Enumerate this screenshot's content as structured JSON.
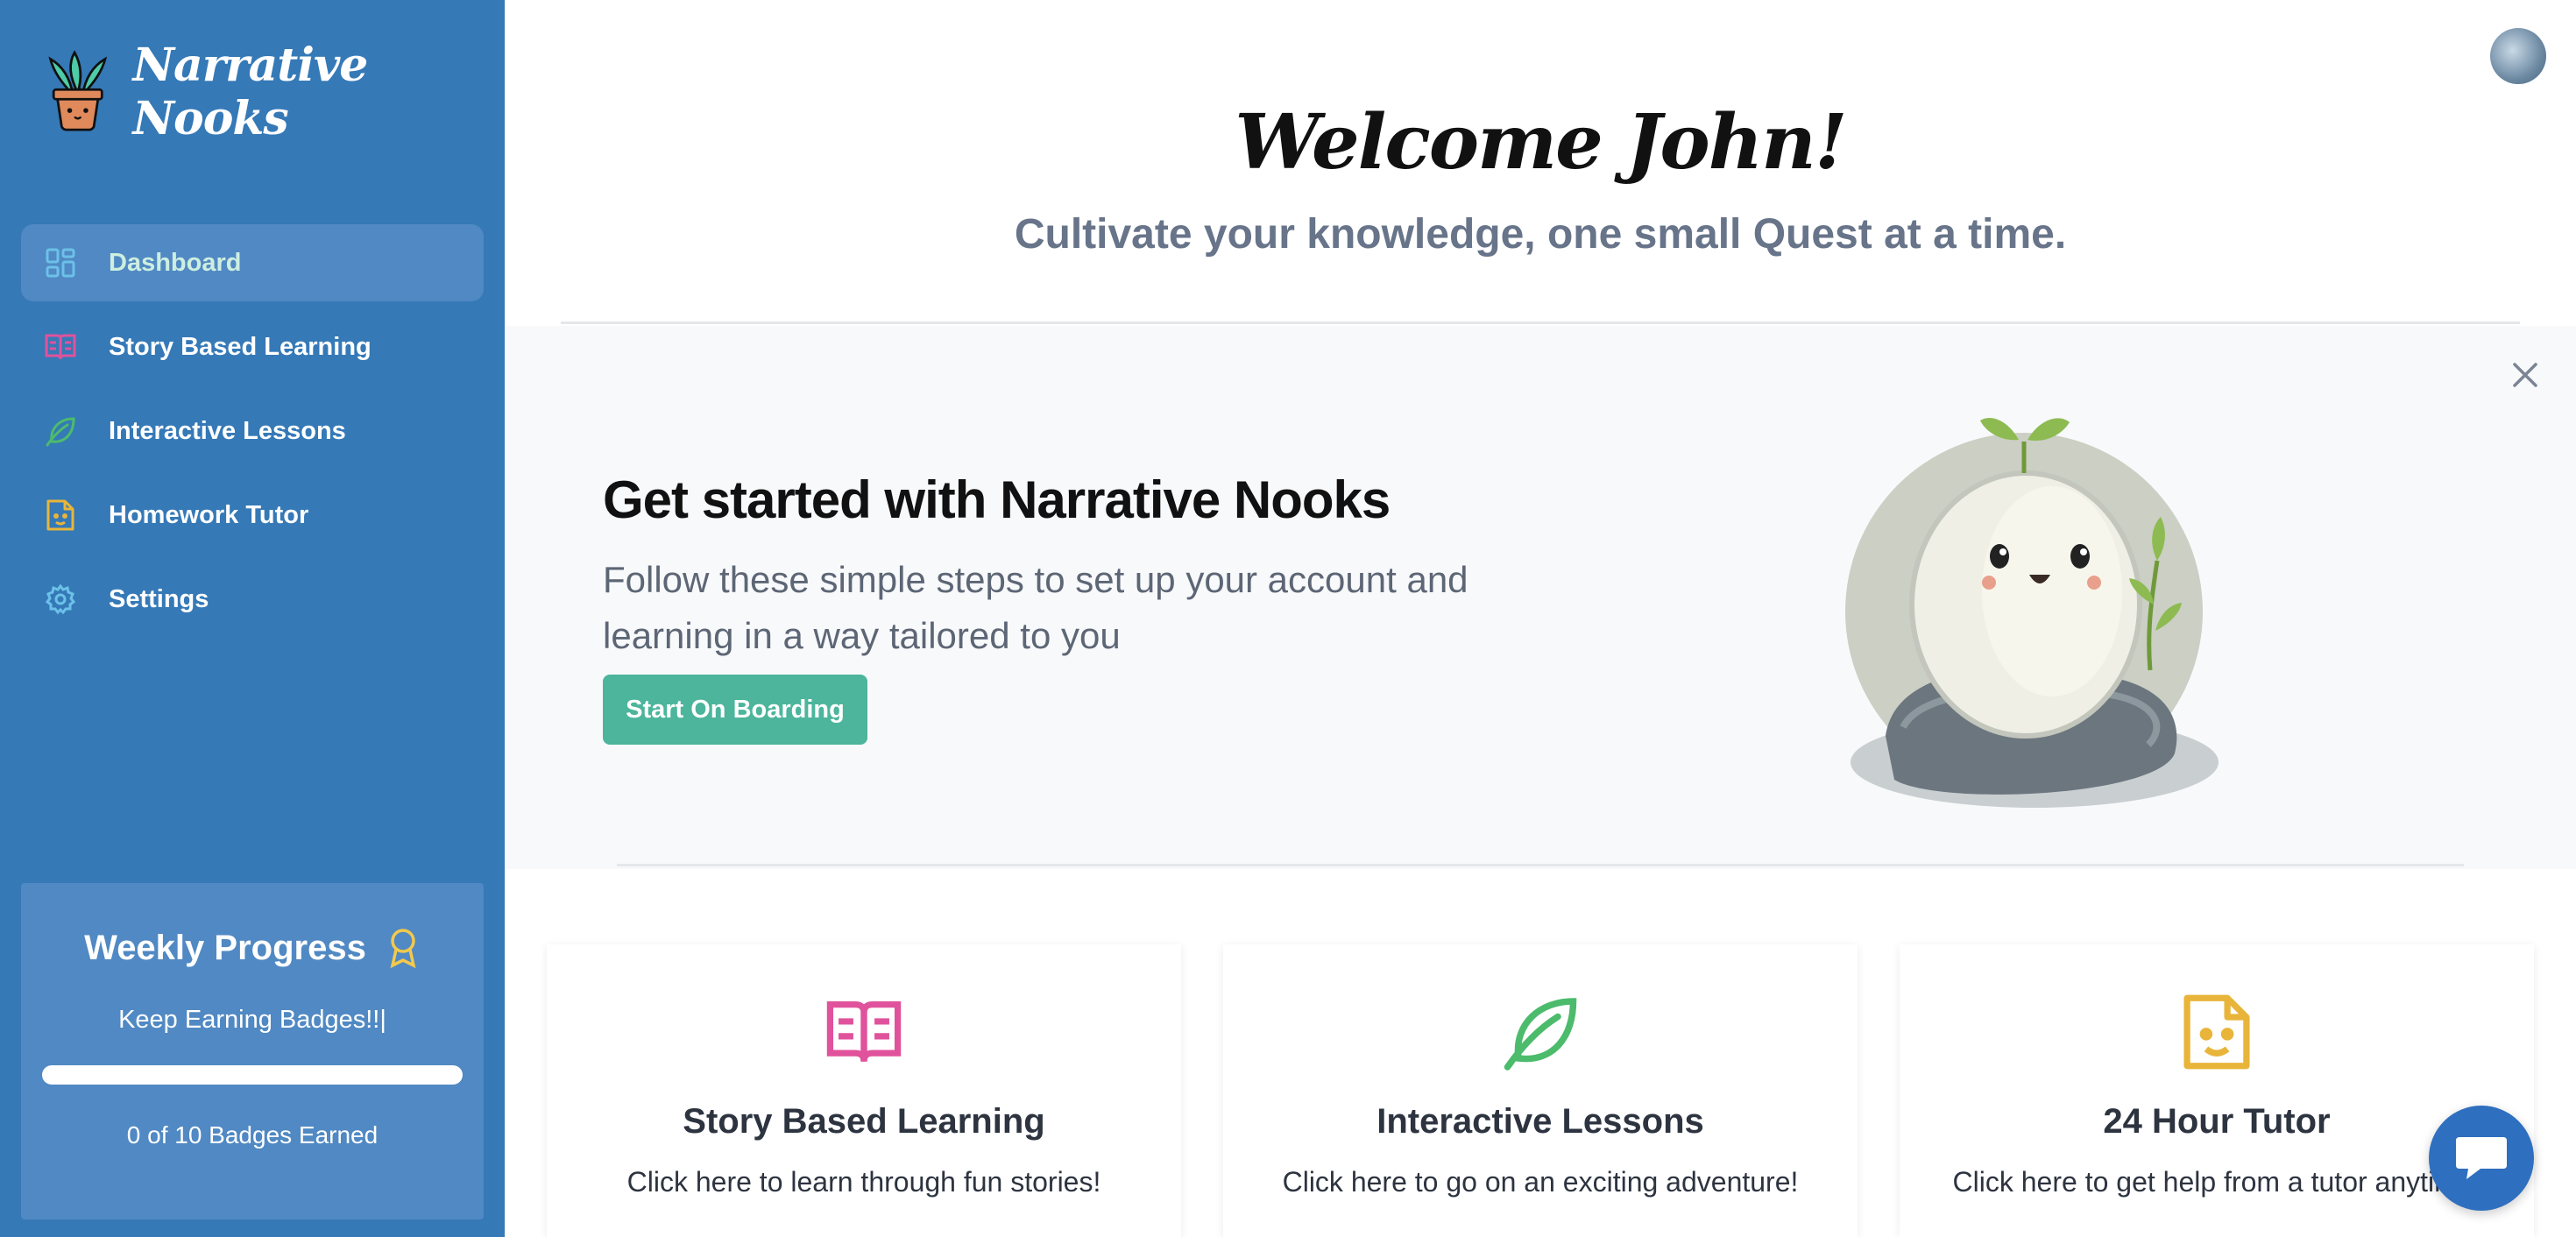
{
  "brand": {
    "title": "Narrative Nooks",
    "logo_icon": "potted-plant-logo"
  },
  "sidebar": {
    "items": [
      {
        "label": "Dashboard",
        "icon": "dashboard-grid-icon",
        "active": true
      },
      {
        "label": "Story Based Learning",
        "icon": "open-book-icon",
        "active": false
      },
      {
        "label": "Interactive Lessons",
        "icon": "leaf-icon",
        "active": false
      },
      {
        "label": "Homework Tutor",
        "icon": "smiley-note-icon",
        "active": false
      },
      {
        "label": "Settings",
        "icon": "gear-icon",
        "active": false
      }
    ]
  },
  "progress": {
    "title": "Weekly Progress",
    "subtitle": "Keep Earning Badges!!",
    "count_text": "0 of 10 Badges Earned",
    "earned": 0,
    "total": 10
  },
  "header": {
    "welcome": "Welcome John!",
    "tagline": "Cultivate your knowledge, one small Quest at a time."
  },
  "banner": {
    "title": "Get started with Narrative Nooks",
    "description": "Follow these simple steps to set up your account and learning in a way tailored to you",
    "button": "Start On Boarding"
  },
  "cards": [
    {
      "title": "Story Based Learning",
      "description": "Click here to learn through fun stories!",
      "icon": "open-book-icon",
      "color": "#e0529c"
    },
    {
      "title": "Interactive Lessons",
      "description": "Click here to go on an exciting adventure!",
      "icon": "leaf-icon",
      "color": "#4cbb6c"
    },
    {
      "title": "24 Hour Tutor",
      "description": "Click here to get help from a tutor anytime!",
      "icon": "smiley-note-icon",
      "color": "#e8b53a"
    }
  ],
  "colors": {
    "sidebar": "#3579b7",
    "accent": "#4cb59c",
    "chat": "#2f6fbf"
  }
}
